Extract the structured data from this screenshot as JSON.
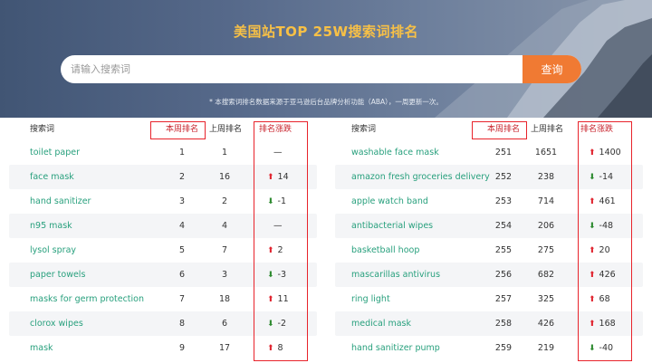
{
  "hero": {
    "title": "美国站TOP 25W搜索词排名",
    "search_placeholder": "请输入搜索词",
    "search_button": "查询",
    "note": "* 本搜索词排名数据来源于亚马逊后台品牌分析功能（ABA），一周更新一次。"
  },
  "left_table": {
    "headers": {
      "keyword": "搜索词",
      "this_week": "本周排名",
      "last_week": "上周排名",
      "change": "排名涨跌"
    },
    "rows": [
      {
        "keyword": "toilet paper",
        "this_week": "1",
        "last_week": "1",
        "change": "—",
        "dir": "none"
      },
      {
        "keyword": "face mask",
        "this_week": "2",
        "last_week": "16",
        "change": "14",
        "dir": "up"
      },
      {
        "keyword": "hand sanitizer",
        "this_week": "3",
        "last_week": "2",
        "change": "-1",
        "dir": "down"
      },
      {
        "keyword": "n95 mask",
        "this_week": "4",
        "last_week": "4",
        "change": "—",
        "dir": "none"
      },
      {
        "keyword": "lysol spray",
        "this_week": "5",
        "last_week": "7",
        "change": "2",
        "dir": "up"
      },
      {
        "keyword": "paper towels",
        "this_week": "6",
        "last_week": "3",
        "change": "-3",
        "dir": "down"
      },
      {
        "keyword": "masks for germ protection",
        "this_week": "7",
        "last_week": "18",
        "change": "11",
        "dir": "up"
      },
      {
        "keyword": "clorox wipes",
        "this_week": "8",
        "last_week": "6",
        "change": "-2",
        "dir": "down"
      },
      {
        "keyword": "mask",
        "this_week": "9",
        "last_week": "17",
        "change": "8",
        "dir": "up"
      }
    ]
  },
  "right_table": {
    "headers": {
      "keyword": "搜索词",
      "this_week": "本周排名",
      "last_week": "上周排名",
      "change": "排名涨跌"
    },
    "rows": [
      {
        "keyword": "washable face mask",
        "this_week": "251",
        "last_week": "1651",
        "change": "1400",
        "dir": "up"
      },
      {
        "keyword": "amazon fresh groceries delivery",
        "this_week": "252",
        "last_week": "238",
        "change": "-14",
        "dir": "down"
      },
      {
        "keyword": "apple watch band",
        "this_week": "253",
        "last_week": "714",
        "change": "461",
        "dir": "up"
      },
      {
        "keyword": "antibacterial wipes",
        "this_week": "254",
        "last_week": "206",
        "change": "-48",
        "dir": "down"
      },
      {
        "keyword": "basketball hoop",
        "this_week": "255",
        "last_week": "275",
        "change": "20",
        "dir": "up"
      },
      {
        "keyword": "mascarillas antivirus",
        "this_week": "256",
        "last_week": "682",
        "change": "426",
        "dir": "up"
      },
      {
        "keyword": "ring light",
        "this_week": "257",
        "last_week": "325",
        "change": "68",
        "dir": "up"
      },
      {
        "keyword": "medical mask",
        "this_week": "258",
        "last_week": "426",
        "change": "168",
        "dir": "up"
      },
      {
        "keyword": "hand sanitizer pump",
        "this_week": "259",
        "last_week": "219",
        "change": "-40",
        "dir": "down"
      }
    ]
  },
  "colors": {
    "accent": "#f07a33",
    "title": "#f7c046",
    "keyword": "#28a07d",
    "up": "#e0242f",
    "down": "#2d8a2f",
    "highlight": "#e8232b"
  },
  "icons": {
    "up": "up-arrow-icon",
    "down": "down-arrow-icon"
  }
}
